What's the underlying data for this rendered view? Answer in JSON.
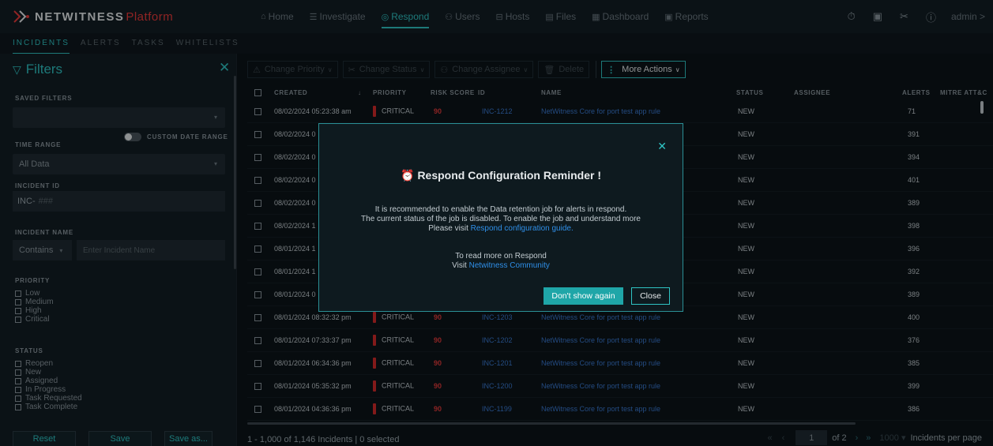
{
  "brand": {
    "name_a": "NETWITNESS",
    "name_b": "Platform"
  },
  "nav": [
    {
      "icon": "⌂",
      "label": "Home"
    },
    {
      "icon": "☰",
      "label": "Investigate"
    },
    {
      "icon": "◎",
      "label": "Respond",
      "active": true
    },
    {
      "icon": "⚇",
      "label": "Users"
    },
    {
      "icon": "⊟",
      "label": "Hosts"
    },
    {
      "icon": "▤",
      "label": "Files"
    },
    {
      "icon": "▦",
      "label": "Dashboard"
    },
    {
      "icon": "▣",
      "label": "Reports"
    }
  ],
  "user": {
    "label": "admin >"
  },
  "subnav": [
    "INCIDENTS",
    "ALERTS",
    "TASKS",
    "WHITELISTS"
  ],
  "filters": {
    "title": "Filters",
    "saved_filters_label": "SAVED FILTERS",
    "time_range_label": "TIME RANGE",
    "custom_date_label": "CUSTOM DATE RANGE",
    "time_range_value": "All Data",
    "incident_id_label": "INCIDENT ID",
    "incident_id_prefix": "INC-",
    "incident_id_placeholder": "###",
    "incident_name_label": "INCIDENT NAME",
    "contains_value": "Contains",
    "incident_name_placeholder": "Enter Incident Name",
    "priority_label": "PRIORITY",
    "priority_options": [
      "Low",
      "Medium",
      "High",
      "Critical"
    ],
    "status_label": "STATUS",
    "status_options": [
      "Reopen",
      "New",
      "Assigned",
      "In Progress",
      "Task Requested",
      "Task Complete"
    ],
    "reset_label": "Reset",
    "save_label": "Save",
    "save_as_label": "Save as..."
  },
  "toolbar": {
    "change_priority": "Change Priority",
    "change_status": "Change Status",
    "change_assignee": "Change Assignee",
    "delete": "Delete",
    "more_actions": "More Actions"
  },
  "table": {
    "columns": [
      "CREATED",
      "PRIORITY",
      "RISK SCORE",
      "ID",
      "NAME",
      "STATUS",
      "ASSIGNEE",
      "ALERTS",
      "MITRE ATT&C"
    ],
    "rows": [
      {
        "created": "08/02/2024 05:23:38 am",
        "priority": "CRITICAL",
        "risk": "90",
        "id": "INC-1212",
        "name": "NetWitness Core for port test app rule",
        "status": "NEW",
        "alerts": "71"
      },
      {
        "created": "08/02/2024 0",
        "priority": "",
        "risk": "",
        "id": "",
        "name": "",
        "status": "NEW",
        "alerts": "391"
      },
      {
        "created": "08/02/2024 0",
        "priority": "",
        "risk": "",
        "id": "",
        "name": "",
        "status": "NEW",
        "alerts": "394"
      },
      {
        "created": "08/02/2024 0",
        "priority": "",
        "risk": "",
        "id": "",
        "name": "",
        "status": "NEW",
        "alerts": "401"
      },
      {
        "created": "08/02/2024 0",
        "priority": "",
        "risk": "",
        "id": "",
        "name": "",
        "status": "NEW",
        "alerts": "389"
      },
      {
        "created": "08/02/2024 1",
        "priority": "",
        "risk": "",
        "id": "",
        "name": "",
        "status": "NEW",
        "alerts": "398"
      },
      {
        "created": "08/01/2024 1",
        "priority": "",
        "risk": "",
        "id": "",
        "name": "",
        "status": "NEW",
        "alerts": "396"
      },
      {
        "created": "08/01/2024 1",
        "priority": "",
        "risk": "",
        "id": "",
        "name": "",
        "status": "NEW",
        "alerts": "392"
      },
      {
        "created": "08/01/2024 0",
        "priority": "",
        "risk": "",
        "id": "",
        "name": "",
        "status": "NEW",
        "alerts": "389"
      },
      {
        "created": "08/01/2024 08:32:32 pm",
        "priority": "CRITICAL",
        "risk": "90",
        "id": "INC-1203",
        "name": "NetWitness Core for port test app rule",
        "status": "NEW",
        "alerts": "400"
      },
      {
        "created": "08/01/2024 07:33:37 pm",
        "priority": "CRITICAL",
        "risk": "90",
        "id": "INC-1202",
        "name": "NetWitness Core for port test app rule",
        "status": "NEW",
        "alerts": "376"
      },
      {
        "created": "08/01/2024 06:34:36 pm",
        "priority": "CRITICAL",
        "risk": "90",
        "id": "INC-1201",
        "name": "NetWitness Core for port test app rule",
        "status": "NEW",
        "alerts": "385"
      },
      {
        "created": "08/01/2024 05:35:32 pm",
        "priority": "CRITICAL",
        "risk": "90",
        "id": "INC-1200",
        "name": "NetWitness Core for port test app rule",
        "status": "NEW",
        "alerts": "399"
      },
      {
        "created": "08/01/2024 04:36:36 pm",
        "priority": "CRITICAL",
        "risk": "90",
        "id": "INC-1199",
        "name": "NetWitness Core for port test app rule",
        "status": "NEW",
        "alerts": "386"
      }
    ]
  },
  "footer": {
    "summary": "1 - 1,000 of 1,146 Incidents | 0 selected",
    "page": "1",
    "of": "of 2",
    "page_size": "1000",
    "per_page": "Incidents per page"
  },
  "modal": {
    "title": "Respond Configuration Reminder !",
    "line1": "It is recommended to enable the Data retention job for alerts in respond.",
    "line2": "The current status of the job is disabled. To enable the job and understand more",
    "line3": "Please visit",
    "link1": "Respond configuration guide.",
    "line4": "To read more on Respond",
    "line5": "Visit",
    "link2": "Netwitness Community",
    "btn_dont_show": "Don't show again",
    "btn_close": "Close"
  },
  "colors": {
    "accent": "#2fc4c4",
    "critical": "#d42b2b",
    "link": "#3a7ad2"
  }
}
